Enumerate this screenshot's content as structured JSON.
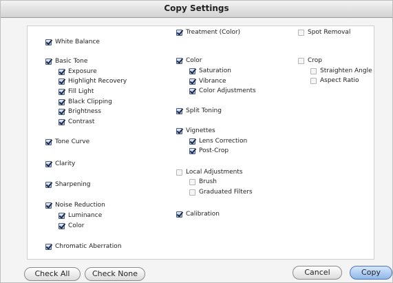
{
  "window": {
    "title": "Copy Settings"
  },
  "col1": [
    {
      "label": "White Balance",
      "checked": true
    },
    {
      "label": "Basic Tone",
      "checked": true
    },
    {
      "label": "Exposure",
      "checked": true
    },
    {
      "label": "Highlight Recovery",
      "checked": true
    },
    {
      "label": "Fill Light",
      "checked": true
    },
    {
      "label": "Black Clipping",
      "checked": true
    },
    {
      "label": "Brightness",
      "checked": true
    },
    {
      "label": "Contrast",
      "checked": true
    },
    {
      "label": "Tone Curve",
      "checked": true
    },
    {
      "label": "Clarity",
      "checked": true
    },
    {
      "label": "Sharpening",
      "checked": true
    },
    {
      "label": "Noise Reduction",
      "checked": true
    },
    {
      "label": "Luminance",
      "checked": true
    },
    {
      "label": "Color",
      "checked": true
    },
    {
      "label": "Chromatic Aberration",
      "checked": true
    }
  ],
  "col2": [
    {
      "label": "Treatment (Color)",
      "checked": true
    },
    {
      "label": "Color",
      "checked": true
    },
    {
      "label": "Saturation",
      "checked": true
    },
    {
      "label": "Vibrance",
      "checked": true
    },
    {
      "label": "Color Adjustments",
      "checked": true
    },
    {
      "label": "Split Toning",
      "checked": true
    },
    {
      "label": "Vignettes",
      "checked": true
    },
    {
      "label": "Lens Correction",
      "checked": true
    },
    {
      "label": "Post-Crop",
      "checked": true
    },
    {
      "label": "Local Adjustments",
      "checked": false
    },
    {
      "label": "Brush",
      "checked": false
    },
    {
      "label": "Graduated Filters",
      "checked": false
    },
    {
      "label": "Calibration",
      "checked": true
    }
  ],
  "col3": [
    {
      "label": "Spot Removal",
      "checked": false
    },
    {
      "label": "Crop",
      "checked": false
    },
    {
      "label": "Straighten Angle",
      "checked": false
    },
    {
      "label": "Aspect Ratio",
      "checked": false
    }
  ],
  "buttons": {
    "check_all": "Check All",
    "check_none": "Check None",
    "cancel": "Cancel",
    "copy": "Copy"
  }
}
